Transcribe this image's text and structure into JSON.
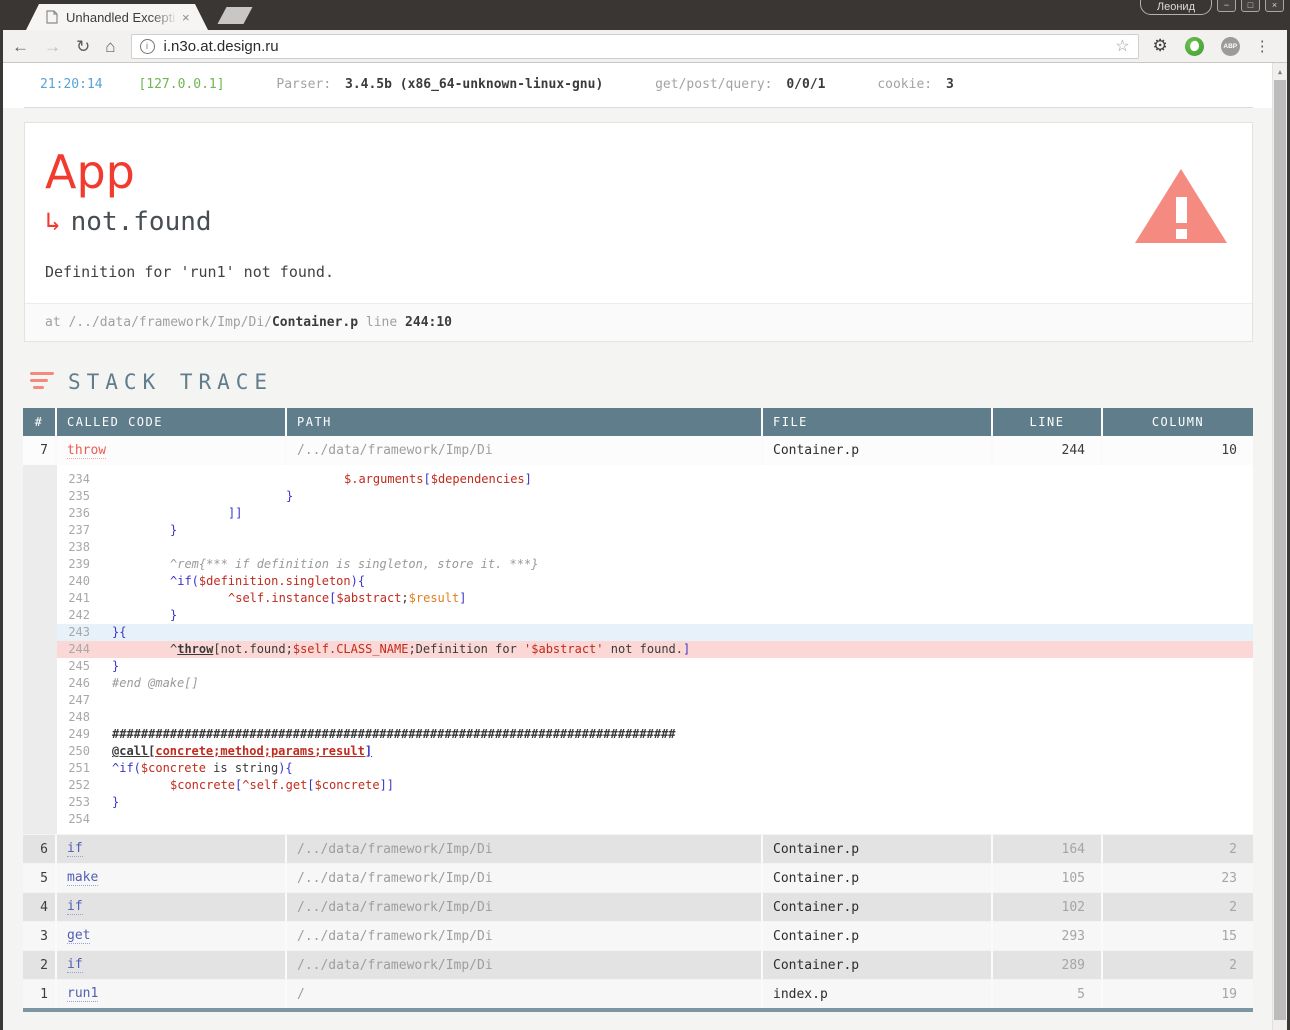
{
  "chrome": {
    "tab_title": "Unhandled Excepti",
    "tab_close": "×",
    "profile": "Леонид",
    "minimize": "−",
    "maximize": "□",
    "close": "×"
  },
  "toolbar": {
    "back": "←",
    "forward": "→",
    "reload": "↻",
    "home": "⌂",
    "info": "i",
    "url": "i.n3o.at.design.ru",
    "star": "☆",
    "gear": "⚙",
    "abp": "ABP",
    "menu": "⋮",
    "scroll_up": "▲"
  },
  "statusbar": {
    "time": "21:20:14",
    "ip": "[127.0.0.1]",
    "parser_label": "Parser:",
    "parser_value": "3.4.5b (x86_64-unknown-linux-gnu)",
    "query_label": "get/post/query:",
    "query_value": "0/0/1",
    "cookie_label": "cookie:",
    "cookie_value": "3"
  },
  "error": {
    "title": "App",
    "arrow": "↳",
    "name": "not.found",
    "message": "Definition for 'run1' not found.",
    "at_label": "at ",
    "path": "/../data/framework/Imp/Di/",
    "file": "Container.p",
    "line_label": " line ",
    "position": "244:10"
  },
  "stack": {
    "heading": "STACK TRACE",
    "columns": [
      "#",
      "CALLED CODE",
      "PATH",
      "FILE",
      "LINE",
      "COLUMN"
    ],
    "rows": [
      {
        "num": 7,
        "code": "throw",
        "path": "/../data/framework/Imp/Di",
        "file": "Container.p",
        "line": "244",
        "column": "10",
        "variant": "active",
        "expanded": true
      },
      {
        "num": 6,
        "code": "if",
        "path": "/../data/framework/Imp/Di",
        "file": "Container.p",
        "line": "164",
        "column": "2",
        "variant": "shade"
      },
      {
        "num": 5,
        "code": "make",
        "path": "/../data/framework/Imp/Di",
        "file": "Container.p",
        "line": "105",
        "column": "23",
        "variant": "light"
      },
      {
        "num": 4,
        "code": "if",
        "path": "/../data/framework/Imp/Di",
        "file": "Container.p",
        "line": "102",
        "column": "2",
        "variant": "shade"
      },
      {
        "num": 3,
        "code": "get",
        "path": "/../data/framework/Imp/Di",
        "file": "Container.p",
        "line": "293",
        "column": "15",
        "variant": "light"
      },
      {
        "num": 2,
        "code": "if",
        "path": "/../data/framework/Imp/Di",
        "file": "Container.p",
        "line": "289",
        "column": "2",
        "variant": "shade"
      },
      {
        "num": 1,
        "code": "run1",
        "path": "/",
        "file": "index.p",
        "line": "5",
        "column": "19",
        "variant": "light"
      }
    ]
  },
  "code": {
    "lines": [
      {
        "no": 234,
        "ind": 4,
        "seg": [
          [
            "v",
            "$.arguments"
          ],
          [
            "b",
            "["
          ],
          [
            "v",
            "$dependencies"
          ],
          [
            "b",
            "]"
          ]
        ]
      },
      {
        "no": 235,
        "ind": 3,
        "seg": [
          [
            "b",
            "}"
          ]
        ]
      },
      {
        "no": 236,
        "ind": 2,
        "seg": [
          [
            "b",
            "]]"
          ]
        ]
      },
      {
        "no": 237,
        "ind": 1,
        "seg": [
          [
            "b",
            "}"
          ]
        ]
      },
      {
        "no": 238,
        "ind": 0,
        "seg": []
      },
      {
        "no": 239,
        "ind": 1,
        "seg": [
          [
            "c",
            "^rem{*** if definition is singleton, store it. ***}"
          ]
        ]
      },
      {
        "no": 240,
        "ind": 1,
        "seg": [
          [
            "b",
            "^if("
          ],
          [
            "v",
            "$definition.singleton"
          ],
          [
            "b",
            "){"
          ]
        ]
      },
      {
        "no": 241,
        "ind": 2,
        "seg": [
          [
            "v",
            "^self.instance"
          ],
          [
            "b",
            "["
          ],
          [
            "v",
            "$abstract"
          ],
          [
            "p",
            ";"
          ],
          [
            "o",
            "$result"
          ],
          [
            "b",
            "]"
          ]
        ]
      },
      {
        "no": 242,
        "ind": 1,
        "seg": [
          [
            "b",
            "}"
          ]
        ]
      },
      {
        "no": 243,
        "ind": 0,
        "hl": "blue",
        "seg": [
          [
            "b",
            "}{"
          ]
        ]
      },
      {
        "no": 244,
        "ind": 1,
        "hl": "red",
        "seg": [
          [
            "p",
            "^"
          ],
          [
            "tu",
            "throw"
          ],
          [
            "p",
            "[not.found;"
          ],
          [
            "v",
            "$self.CLASS_NAME"
          ],
          [
            "p",
            ";Definition for "
          ],
          [
            "v",
            "'$abstract'"
          ],
          [
            "p",
            " not found."
          ],
          [
            "b",
            "]"
          ]
        ]
      },
      {
        "no": 245,
        "ind": 0,
        "seg": [
          [
            "b",
            "}"
          ]
        ]
      },
      {
        "no": 246,
        "ind": 0,
        "seg": [
          [
            "c",
            "#end @make[]"
          ]
        ]
      },
      {
        "no": 247,
        "ind": 0,
        "seg": []
      },
      {
        "no": 248,
        "ind": 0,
        "seg": []
      },
      {
        "no": 249,
        "ind": 0,
        "seg": [
          [
            "h",
            "##############################################################################"
          ]
        ]
      },
      {
        "no": 250,
        "ind": 0,
        "seg": [
          [
            "tu",
            "@call["
          ],
          [
            "vu",
            "concrete;method;params;result"
          ],
          [
            "bu",
            "]"
          ]
        ]
      },
      {
        "no": 251,
        "ind": 0,
        "seg": [
          [
            "b",
            "^if("
          ],
          [
            "v",
            "$concrete"
          ],
          [
            "p",
            " is string"
          ],
          [
            "b",
            "){"
          ]
        ]
      },
      {
        "no": 252,
        "ind": 1,
        "seg": [
          [
            "v",
            "$concrete"
          ],
          [
            "b",
            "["
          ],
          [
            "v",
            "^self.get"
          ],
          [
            "b",
            "["
          ],
          [
            "v",
            "$concrete"
          ],
          [
            "b",
            "]]"
          ]
        ]
      },
      {
        "no": 253,
        "ind": 0,
        "seg": [
          [
            "b",
            "}"
          ]
        ]
      },
      {
        "no": 254,
        "ind": 0,
        "seg": []
      }
    ]
  }
}
